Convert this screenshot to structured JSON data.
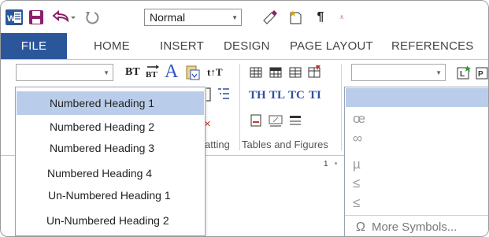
{
  "qat": {
    "style_value": "Normal"
  },
  "tabs": [
    {
      "label": "FILE"
    },
    {
      "label": "HOME"
    },
    {
      "label": "INSERT"
    },
    {
      "label": "DESIGN"
    },
    {
      "label": "PAGE LAYOUT"
    },
    {
      "label": "REFERENCES"
    }
  ],
  "ribbon": {
    "row1": [
      "BT",
      "TH",
      "TL",
      "TC",
      "TI"
    ],
    "groups": {
      "formatting_partial": "atting",
      "tables_figures": "Tables and Figures"
    },
    "ruler_value": "1"
  },
  "heading_menu": {
    "items": [
      {
        "label": "Numbered Heading 1",
        "selected": true
      },
      {
        "label": "Numbered Heading 2",
        "selected": false
      },
      {
        "label": "Numbered Heading 3",
        "selected": false
      },
      {
        "label": "Numbered Heading 4",
        "selected": false
      },
      {
        "label": "Un-Numbered Heading 1",
        "selected": false
      },
      {
        "label": "Un-Numbered Heading 2",
        "selected": false
      }
    ]
  },
  "symbol_menu": {
    "items": [
      "œ",
      "∞",
      "µ",
      "≤",
      "≤"
    ],
    "more_label": "More Symbols..."
  },
  "colors": {
    "file_tab": "#2b579a",
    "selection": "#b9cdea",
    "accent_blue": "#2f4fa0"
  }
}
